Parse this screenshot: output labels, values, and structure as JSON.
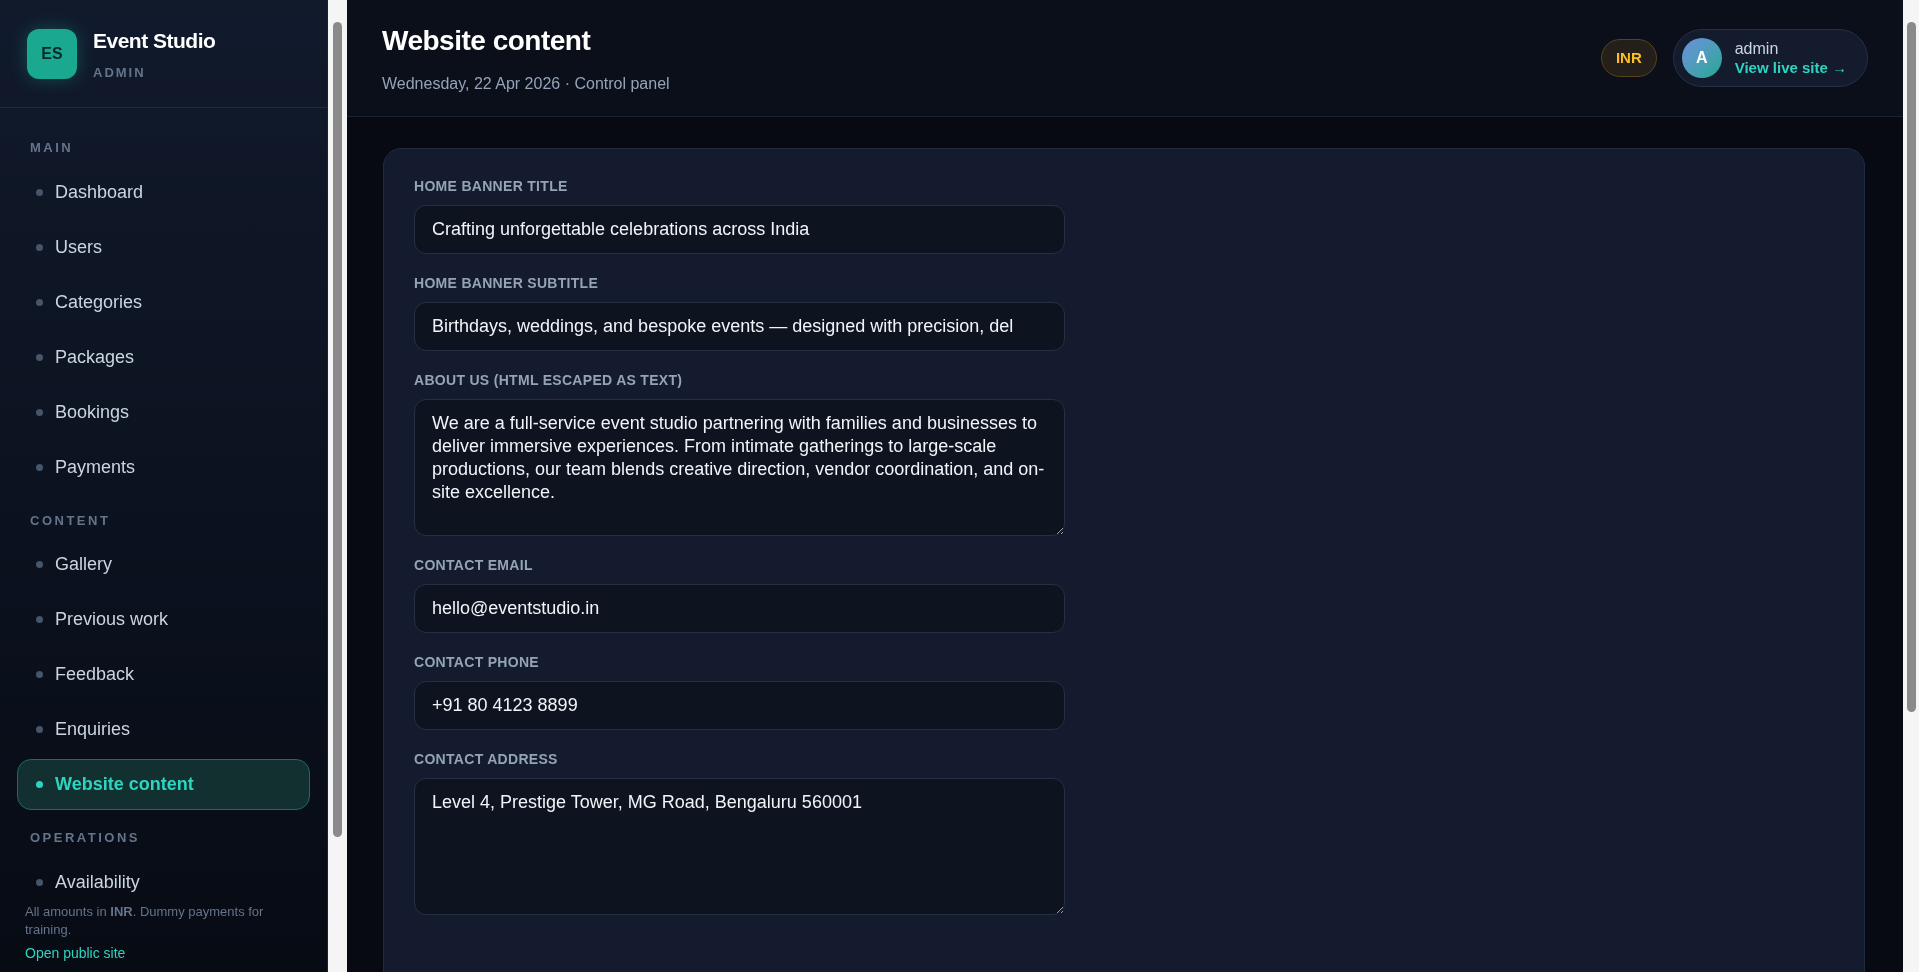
{
  "brand": {
    "initials": "ES",
    "name": "Event Studio",
    "role": "ADMIN"
  },
  "sidebar": {
    "sections": [
      {
        "title": "MAIN",
        "items": [
          {
            "label": "Dashboard",
            "selected": false
          },
          {
            "label": "Users",
            "selected": false
          },
          {
            "label": "Categories",
            "selected": false
          },
          {
            "label": "Packages",
            "selected": false
          },
          {
            "label": "Bookings",
            "selected": false
          },
          {
            "label": "Payments",
            "selected": false
          }
        ]
      },
      {
        "title": "CONTENT",
        "items": [
          {
            "label": "Gallery",
            "selected": false
          },
          {
            "label": "Previous work",
            "selected": false
          },
          {
            "label": "Feedback",
            "selected": false
          },
          {
            "label": "Enquiries",
            "selected": false
          },
          {
            "label": "Website content",
            "selected": true
          }
        ]
      },
      {
        "title": "OPERATIONS",
        "items": [
          {
            "label": "Availability",
            "selected": false
          }
        ]
      }
    ],
    "footer_note": "All amounts in **INR**. Dummy payments for training.",
    "footer_link": "Open public site"
  },
  "header": {
    "title": "Website content",
    "subtitle": "Wednesday, 22 Apr 2026 · Control panel",
    "currency": "INR",
    "user": {
      "initial": "A",
      "name": "admin",
      "link": "View live site →"
    }
  },
  "form": {
    "fields": [
      {
        "label": "HOME BANNER TITLE",
        "kind": "input",
        "value": "Crafting unforgettable celebrations across India"
      },
      {
        "label": "HOME BANNER SUBTITLE",
        "kind": "input",
        "value": "Birthdays, weddings, and bespoke events — designed with precision, del"
      },
      {
        "label": "ABOUT US (HTML ESCAPED AS TEXT)",
        "kind": "textarea",
        "value": "We are a full-service event studio partnering with families and businesses to deliver immersive experiences. From intimate gatherings to large-scale productions, our team blends creative direction, vendor coordination, and on-site excellence."
      },
      {
        "label": "CONTACT EMAIL",
        "kind": "input",
        "value": "hello@eventstudio.in"
      },
      {
        "label": "CONTACT PHONE",
        "kind": "input",
        "value": "+91 80 4123 8899"
      },
      {
        "label": "CONTACT ADDRESS",
        "kind": "textarea",
        "value": "Level 4, Prestige Tower, MG Road, Bengaluru 560001"
      }
    ]
  }
}
